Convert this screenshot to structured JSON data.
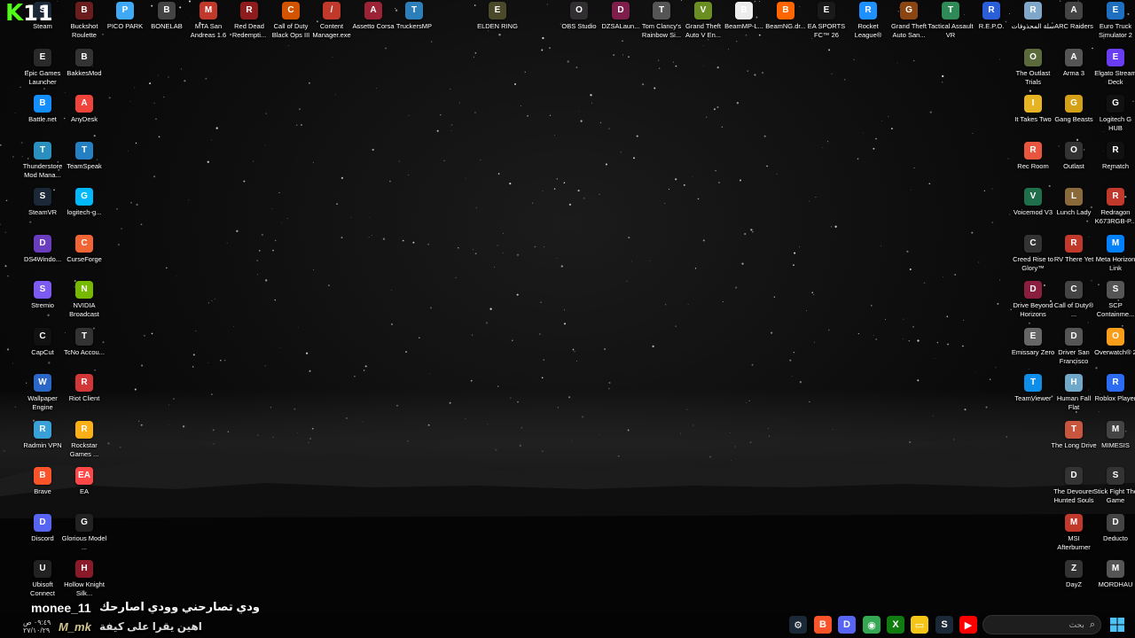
{
  "desktop": {
    "icons": [
      {
        "label": "Steam",
        "color": "#1b2838",
        "glyph": "S"
      },
      {
        "label": "Buckshot Roulette",
        "color": "#6b1d1d",
        "glyph": "B"
      },
      {
        "label": "PICO PARK",
        "color": "#3fa9f5",
        "glyph": "P"
      },
      {
        "label": "BONELAB",
        "color": "#444444",
        "glyph": "B"
      },
      {
        "label": "MTA San Andreas 1.6",
        "color": "#c0392b",
        "glyph": "M"
      },
      {
        "label": "Red Dead Redempti...",
        "color": "#8e1c1c",
        "glyph": "R"
      },
      {
        "label": "Call of Duty Black Ops III",
        "color": "#d35400",
        "glyph": "C"
      },
      {
        "label": "Content Manager.exe",
        "color": "#c0392b",
        "glyph": "/"
      },
      {
        "label": "Assetto Corsa",
        "color": "#9b2335",
        "glyph": "A"
      },
      {
        "label": "TruckersMP",
        "color": "#2c7fb8",
        "glyph": "T"
      },
      {
        "label": "ELDEN RING",
        "color": "#4a4a2a",
        "glyph": "E"
      },
      {
        "label": "OBS Studio",
        "color": "#302e31",
        "glyph": "O"
      },
      {
        "label": "DZSALaun...",
        "color": "#7d1f4a",
        "glyph": "D"
      },
      {
        "label": "Tom Clancy's Rainbow Si...",
        "color": "#555555",
        "glyph": "T"
      },
      {
        "label": "Grand Theft Auto V En...",
        "color": "#6b8e23",
        "glyph": "V"
      },
      {
        "label": "BeamMP-L...",
        "color": "#ececec",
        "glyph": "B"
      },
      {
        "label": "BeamNG.dr...",
        "color": "#ff6600",
        "glyph": "B"
      },
      {
        "label": "EA SPORTS FC™ 26",
        "color": "#1a1a1a",
        "glyph": "E"
      },
      {
        "label": "Rocket League®",
        "color": "#1e90ff",
        "glyph": "R"
      },
      {
        "label": "Grand Theft Auto San...",
        "color": "#8b4513",
        "glyph": "G"
      },
      {
        "label": "Tactical Assault VR",
        "color": "#2e8b57",
        "glyph": "T"
      },
      {
        "label": "R.E.P.O.",
        "color": "#2b5fd9",
        "glyph": "R"
      },
      {
        "label": "سلة المحذوفات",
        "color": "#7fa7c9",
        "glyph": "R"
      },
      {
        "label": "ARC Raiders",
        "color": "#444444",
        "glyph": "A"
      },
      {
        "label": "Euro Truck Simulator 2",
        "color": "#1e6fbf",
        "glyph": "E"
      },
      {
        "label": "Epic Games Launcher",
        "color": "#2a2a2a",
        "glyph": "E"
      },
      {
        "label": "BakkesMod",
        "color": "#333333",
        "glyph": "B"
      },
      {
        "label": "Battle.net",
        "color": "#148eff",
        "glyph": "B"
      },
      {
        "label": "AnyDesk",
        "color": "#ef443b",
        "glyph": "A"
      },
      {
        "label": "Thunderstore Mod Mana...",
        "color": "#2b8fbf",
        "glyph": "T"
      },
      {
        "label": "TeamSpeak",
        "color": "#2580c3",
        "glyph": "T"
      },
      {
        "label": "SteamVR",
        "color": "#1b2838",
        "glyph": "S"
      },
      {
        "label": "logitech-g...",
        "color": "#00b8fc",
        "glyph": "G"
      },
      {
        "label": "DS4Windo...",
        "color": "#6a3dbf",
        "glyph": "D"
      },
      {
        "label": "CurseForge",
        "color": "#f16436",
        "glyph": "C"
      },
      {
        "label": "Stremio",
        "color": "#7b5bf2",
        "glyph": "S"
      },
      {
        "label": "NVIDIA Broadcast",
        "color": "#76b900",
        "glyph": "N"
      },
      {
        "label": "CapCut",
        "color": "#111111",
        "glyph": "C"
      },
      {
        "label": "TcNo Accou...",
        "color": "#333333",
        "glyph": "T"
      },
      {
        "label": "Wallpaper Engine",
        "color": "#2b67c7",
        "glyph": "W"
      },
      {
        "label": "Riot Client",
        "color": "#d13639",
        "glyph": "R"
      },
      {
        "label": "Radmin VPN",
        "color": "#3aa0d8",
        "glyph": "R"
      },
      {
        "label": "Rockstar Games ...",
        "color": "#fcaf17",
        "glyph": "R"
      },
      {
        "label": "Brave",
        "color": "#fb542b",
        "glyph": "B"
      },
      {
        "label": "EA",
        "color": "#ff4747",
        "glyph": "EA"
      },
      {
        "label": "Discord",
        "color": "#5865f2",
        "glyph": "D"
      },
      {
        "label": "Glorious Model ...",
        "color": "#222222",
        "glyph": "G"
      },
      {
        "label": "Ubisoft Connect",
        "color": "#222222",
        "glyph": "U"
      },
      {
        "label": "Hollow Knight Silk...",
        "color": "#8a1a2a",
        "glyph": "H"
      },
      {
        "label": "The Outlast Trials",
        "color": "#5a6a3a",
        "glyph": "O"
      },
      {
        "label": "Arma 3",
        "color": "#555555",
        "glyph": "A"
      },
      {
        "label": "Elgato Stream Deck",
        "color": "#6b3df2",
        "glyph": "E"
      },
      {
        "label": "It Takes Two",
        "color": "#e6b422",
        "glyph": "I"
      },
      {
        "label": "Gang Beasts",
        "color": "#d4a017",
        "glyph": "G"
      },
      {
        "label": "Logitech G HUB",
        "color": "#111111",
        "glyph": "G"
      },
      {
        "label": "Rec Room",
        "color": "#e8563f",
        "glyph": "R"
      },
      {
        "label": "Outlast",
        "color": "#333333",
        "glyph": "O"
      },
      {
        "label": "Rematch",
        "color": "#111111",
        "glyph": "R"
      },
      {
        "label": "Voicemod V3",
        "color": "#1f6f4a",
        "glyph": "V"
      },
      {
        "label": "Lunch Lady",
        "color": "#8a6a3a",
        "glyph": "L"
      },
      {
        "label": "Redragon K673RGB-P...",
        "color": "#c0392b",
        "glyph": "R"
      },
      {
        "label": "Creed Rise to Glory™",
        "color": "#333333",
        "glyph": "C"
      },
      {
        "label": "RV There Yet",
        "color": "#c0392b",
        "glyph": "R"
      },
      {
        "label": "Meta Horizon Link",
        "color": "#0081fb",
        "glyph": "M"
      },
      {
        "label": "Drive Beyond Horizons",
        "color": "#8b1e3f",
        "glyph": "D"
      },
      {
        "label": "Call of Duty® ...",
        "color": "#444444",
        "glyph": "C"
      },
      {
        "label": "SCP Containme...",
        "color": "#555555",
        "glyph": "S"
      },
      {
        "label": "Emissary Zero",
        "color": "#666666",
        "glyph": "E"
      },
      {
        "label": "Driver San Francisco",
        "color": "#555555",
        "glyph": "D"
      },
      {
        "label": "Overwatch® 2",
        "color": "#f99e1a",
        "glyph": "O"
      },
      {
        "label": "TeamViewer",
        "color": "#0e8ee9",
        "glyph": "T"
      },
      {
        "label": "Human Fall Flat",
        "color": "#6fa8c9",
        "glyph": "H"
      },
      {
        "label": "Roblox Player",
        "color": "#2b6cf2",
        "glyph": "R"
      },
      {
        "label": "The Long Drive",
        "color": "#c8553d",
        "glyph": "T"
      },
      {
        "label": "MIMESIS",
        "color": "#444444",
        "glyph": "M"
      },
      {
        "label": "The Devourer Hunted Souls",
        "color": "#333333",
        "glyph": "D"
      },
      {
        "label": "Stick Fight The Game",
        "color": "#333333",
        "glyph": "S"
      },
      {
        "label": "MSI Afterburner",
        "color": "#c0392b",
        "glyph": "M"
      },
      {
        "label": "Deducto",
        "color": "#444444",
        "glyph": "D"
      },
      {
        "label": "DayZ",
        "color": "#333333",
        "glyph": "Z"
      },
      {
        "label": "MORDHAU",
        "color": "#555555",
        "glyph": "M"
      }
    ]
  },
  "overlay": {
    "channel_logo": {
      "k": "K",
      "num": "11"
    },
    "username": "monee_11",
    "arabic_line_1": "ودي تصارحني وودي اصارحك",
    "signature": "M_mk",
    "arabic_line_2": "اهين يقرا على كيفة"
  },
  "taskbar": {
    "clock_time": "٠٩:٤٩ ص",
    "clock_date": "٢٧/١٠/٢٩",
    "search_placeholder": "بحث",
    "pinned": [
      {
        "name": "steam-tray-icon",
        "color": "#1b2838",
        "glyph": "⚙"
      },
      {
        "name": "brave-taskbar-icon",
        "color": "#fb542b",
        "glyph": "B"
      },
      {
        "name": "discord-taskbar-icon",
        "color": "#5865f2",
        "glyph": "D"
      },
      {
        "name": "chrome-taskbar-icon",
        "color": "#34a853",
        "glyph": "◉"
      },
      {
        "name": "xbox-taskbar-icon",
        "color": "#107c10",
        "glyph": "X"
      },
      {
        "name": "file-explorer-taskbar-icon",
        "color": "#f5c518",
        "glyph": "▭"
      },
      {
        "name": "steam-taskbar-icon",
        "color": "#1b2838",
        "glyph": "S"
      },
      {
        "name": "youtube-taskbar-icon",
        "color": "#ff0000",
        "glyph": "▶"
      }
    ]
  }
}
